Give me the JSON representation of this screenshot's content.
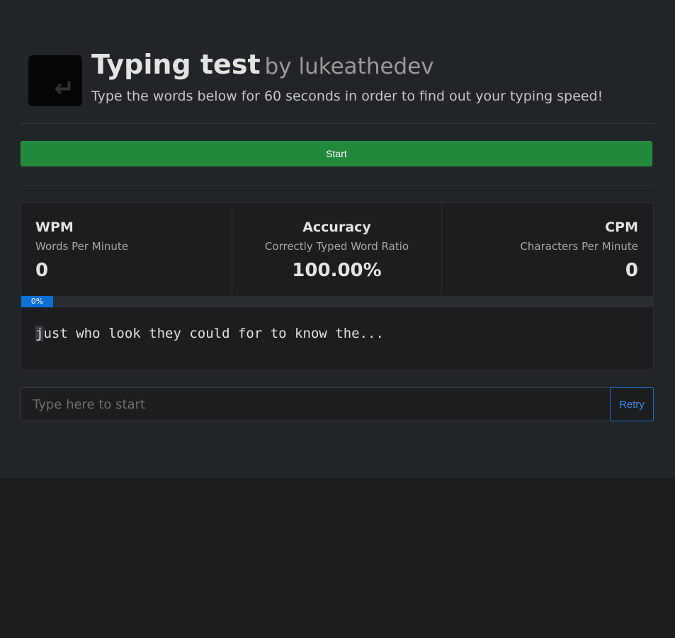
{
  "header": {
    "logo_icon": "enter-key-icon",
    "logo_glyph": "↵",
    "title": "Typing test",
    "byline": "by lukeathedev",
    "subtitle": "Type the words below for 60 seconds in order to find out your typing speed!"
  },
  "start_button": {
    "label": "Start",
    "color": "#22883c"
  },
  "stats": {
    "wpm": {
      "title": "WPM",
      "subtitle": "Words Per Minute",
      "value": "0"
    },
    "accuracy": {
      "title": "Accuracy",
      "subtitle": "Correctly Typed Word Ratio",
      "value": "100.00%"
    },
    "cpm": {
      "title": "CPM",
      "subtitle": "Characters Per Minute",
      "value": "0"
    }
  },
  "progress": {
    "label": "0%",
    "fraction": 0,
    "color": "#0d6fd8"
  },
  "words": {
    "current_char": "j",
    "rest": "ust who look they could for to know the..."
  },
  "input": {
    "placeholder": "Type here to start",
    "value": ""
  },
  "retry_button": {
    "label": "Retry",
    "color": "#3b8ee8"
  }
}
